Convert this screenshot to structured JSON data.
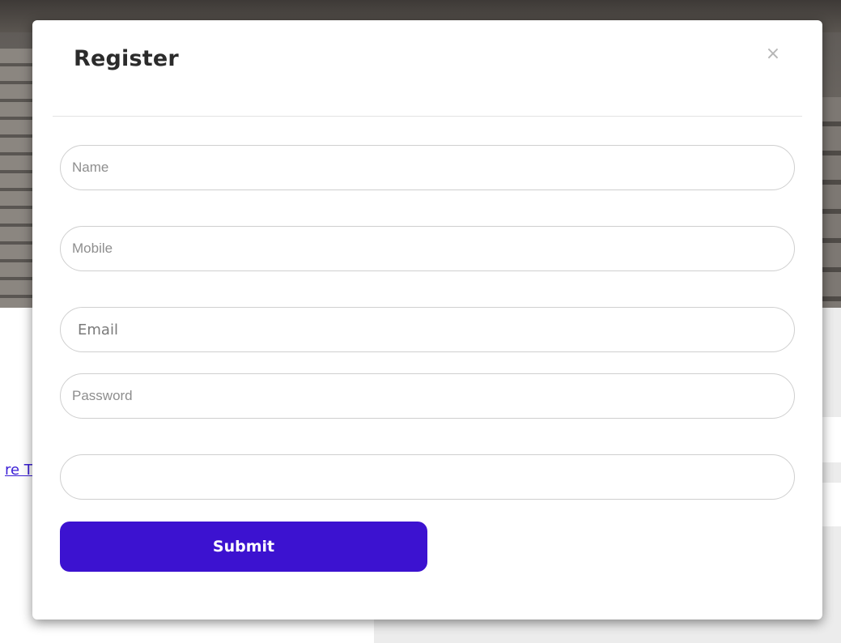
{
  "background": {
    "link_text": "re T"
  },
  "modal": {
    "title": "Register",
    "close_symbol": "×",
    "fields": {
      "name_placeholder": "Name",
      "mobile_placeholder": "Mobile",
      "email_placeholder": "Email",
      "password_placeholder": "Password",
      "extra_value": ""
    },
    "submit_label": "Submit"
  },
  "colors": {
    "accent": "#3c12d0",
    "link": "#3b1fd6"
  },
  "icons": {
    "close": "close-icon"
  }
}
